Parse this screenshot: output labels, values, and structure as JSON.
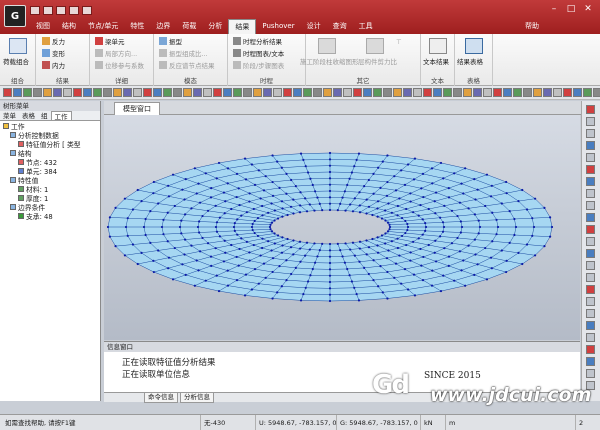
{
  "app": {
    "logo_text": "G",
    "help_label": "帮助"
  },
  "tabs": [
    "视图",
    "结构",
    "节点/单元",
    "特性",
    "边界",
    "荷载",
    "分析",
    "结果",
    "Pushover",
    "设计",
    "查询",
    "工具"
  ],
  "active_tab": "结果",
  "ribbon": {
    "groups": [
      {
        "caption": "组合",
        "items": [
          "荷载组合"
        ]
      },
      {
        "caption": "结果",
        "items": [
          "反力",
          "变形",
          "内力"
        ]
      },
      {
        "caption": "详细",
        "items": [
          "梁单元",
          "局部方向...",
          "位移参与系数"
        ]
      },
      {
        "caption": "模态",
        "items": [
          "振型",
          "振型组成比...",
          "反应谱节点结果"
        ]
      },
      {
        "caption": "时程",
        "items": [
          "时程分析结果",
          "时程图表/文本",
          "阶段/步骤图表"
        ]
      },
      {
        "caption": "其它",
        "items": [
          "施工阶段柱收缩图形",
          "层构件剪力比"
        ]
      },
      {
        "caption": "文本",
        "items": [
          "文本结果"
        ]
      },
      {
        "caption": "表格",
        "items": [
          "结果表格"
        ]
      }
    ]
  },
  "left_panel": {
    "title": "树形菜单",
    "tabs": [
      "菜单",
      "表格",
      "组",
      "工作"
    ],
    "active_tab": "工作",
    "tree": [
      {
        "label": "工作",
        "level": 0
      },
      {
        "label": "分析控制数据",
        "level": 1
      },
      {
        "label": "特征值分析 [ 类型",
        "level": 2
      },
      {
        "label": "结构",
        "level": 1
      },
      {
        "label": "节点: 432",
        "level": 2
      },
      {
        "label": "单元: 384",
        "level": 2
      },
      {
        "label": "特性值",
        "level": 1
      },
      {
        "label": "材料: 1",
        "level": 2
      },
      {
        "label": "厚度: 1",
        "level": 2
      },
      {
        "label": "边界条件",
        "level": 1
      },
      {
        "label": "支承: 48",
        "level": 2
      }
    ]
  },
  "model_window": {
    "tab_label": "模型窗口",
    "mesh": {
      "rings": 9,
      "segments": 48,
      "color": "#a6d7f2",
      "line_color": "#1a4aa0",
      "node_color": "#0a1aa8"
    }
  },
  "info_window": {
    "title": "信息窗口",
    "messages": [
      "正在读取特征值分析结果",
      "正在读取单位信息"
    ],
    "tabs": [
      "命令信息",
      "分析信息"
    ]
  },
  "status": {
    "hint": "如需查找帮助, 请按F1键",
    "none_label": "无-430",
    "u_coord": "U: 5948.67, -783.157, 0",
    "g_coord": "G: 5948.67, -783.157, 0",
    "unit": "kN",
    "length_unit": "m",
    "page": "2"
  },
  "watermark": {
    "logo": "Gd",
    "since": "SINCE 2015",
    "url": "www.jdcui.com"
  },
  "colors": {
    "title_red": "#b12a2a",
    "viewport_top": "#d6dbe4",
    "mesh_fill": "#a6d7f2"
  }
}
